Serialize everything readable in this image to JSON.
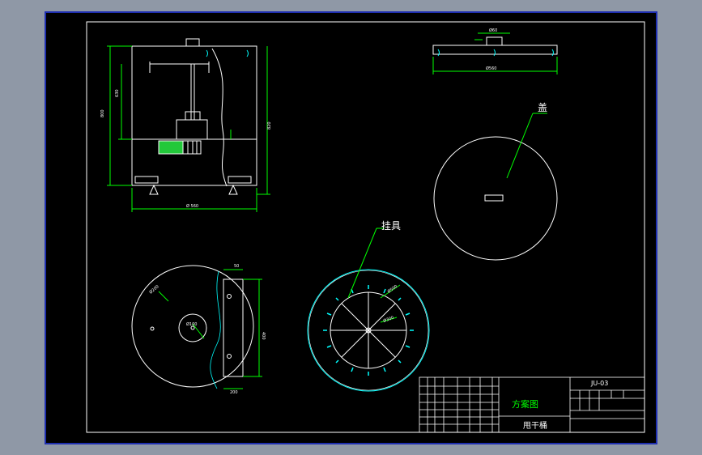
{
  "drawing": {
    "labels": {
      "lid": "盖",
      "hanger": "挂具"
    },
    "title_block": {
      "code": "JU-03",
      "scheme": "方案图",
      "name": "甩干桶"
    },
    "colors": {
      "background": "#000000",
      "line": "#ffffff",
      "dimension": "#00ff00",
      "cyan": "#00ffff",
      "label_green": "#00ff00",
      "frame_blue": "#1f2fb0",
      "outer": "#8f98a6"
    }
  }
}
